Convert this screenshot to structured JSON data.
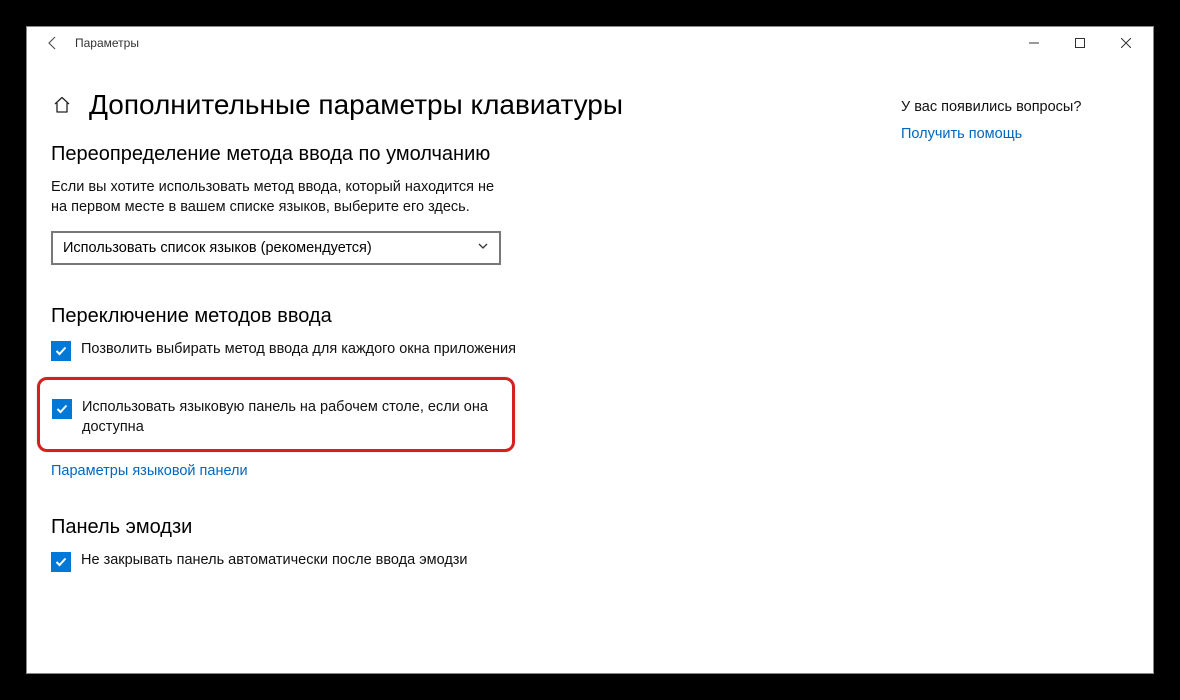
{
  "titlebar": {
    "app_name": "Параметры"
  },
  "header": {
    "title": "Дополнительные параметры клавиатуры"
  },
  "section_default": {
    "heading": "Переопределение метода ввода по умолчанию",
    "description": "Если вы хотите использовать метод ввода, который находится не на первом месте в вашем списке языков, выберите его здесь.",
    "select_value": "Использовать список языков (рекомендуется)"
  },
  "section_switch": {
    "heading": "Переключение методов ввода",
    "check1_label": "Позволить выбирать метод ввода для каждого окна приложения",
    "check2_label": "Использовать языковую панель на рабочем столе, если она доступна",
    "link": "Параметры языковой панели"
  },
  "section_emoji": {
    "heading": "Панель эмодзи",
    "check_label": "Не закрывать панель автоматически после ввода эмодзи"
  },
  "sidebar": {
    "question": "У вас появились вопросы?",
    "help_link": "Получить помощь"
  }
}
